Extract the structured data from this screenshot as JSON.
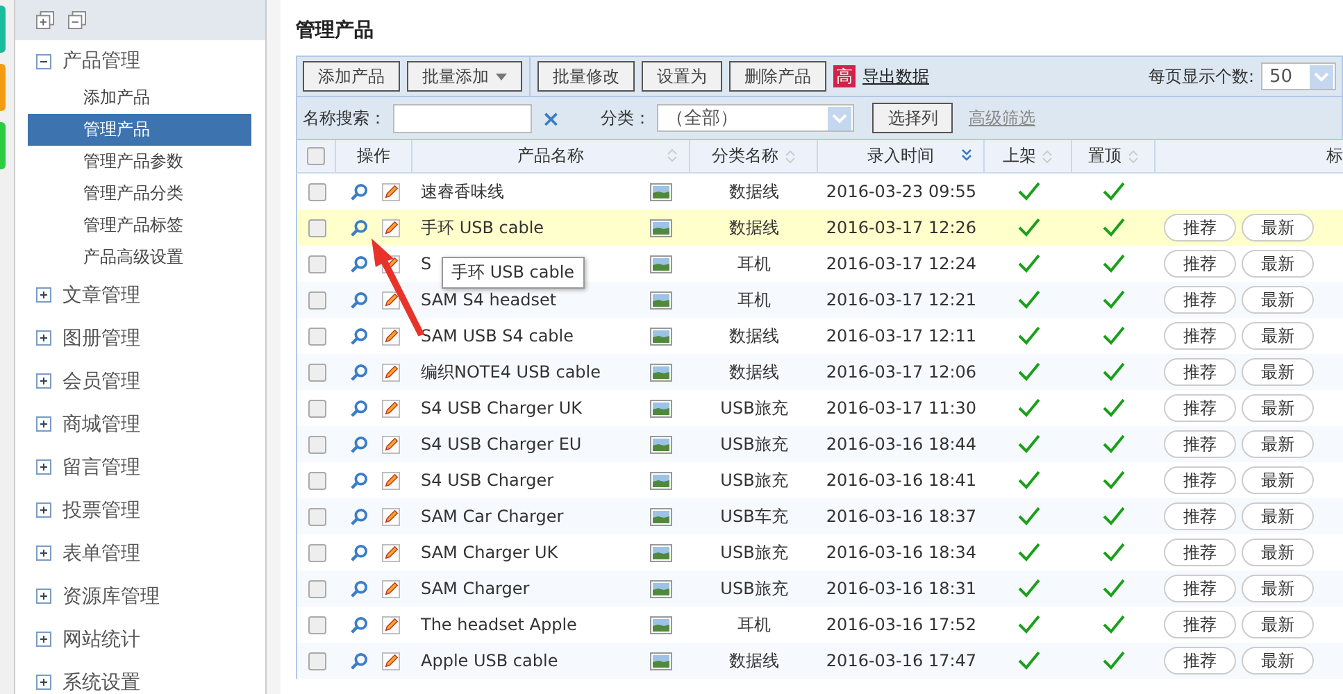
{
  "sidebar": {
    "groups": [
      {
        "label": "产品管理",
        "expanded": true,
        "children": [
          {
            "label": "添加产品",
            "selected": false
          },
          {
            "label": "管理产品",
            "selected": true
          },
          {
            "label": "管理产品参数",
            "selected": false
          },
          {
            "label": "管理产品分类",
            "selected": false
          },
          {
            "label": "管理产品标签",
            "selected": false
          },
          {
            "label": "产品高级设置",
            "selected": false
          }
        ]
      },
      {
        "label": "文章管理",
        "expanded": false
      },
      {
        "label": "图册管理",
        "expanded": false
      },
      {
        "label": "会员管理",
        "expanded": false
      },
      {
        "label": "商城管理",
        "expanded": false
      },
      {
        "label": "留言管理",
        "expanded": false
      },
      {
        "label": "投票管理",
        "expanded": false
      },
      {
        "label": "表单管理",
        "expanded": false
      },
      {
        "label": "资源库管理",
        "expanded": false
      },
      {
        "label": "网站统计",
        "expanded": false
      },
      {
        "label": "系统设置",
        "expanded": false
      }
    ]
  },
  "page_title": "管理产品",
  "toolbar": {
    "buttons": [
      {
        "label": "添加产品",
        "dropdown": false
      },
      {
        "label": "批量添加",
        "dropdown": true
      },
      {
        "label": "批量修改",
        "dropdown": false
      },
      {
        "label": "设置为",
        "dropdown": false
      },
      {
        "label": "删除产品",
        "dropdown": false
      }
    ],
    "export_badge": "高",
    "export_link": "导出数据",
    "per_page_label": "每页显示个数:",
    "per_page": "50"
  },
  "filter": {
    "search_label": "名称搜索：",
    "clear": "×",
    "category_label": "分类：",
    "category": "（全部）",
    "columns_button": "选择列",
    "advanced_link": "高级筛选"
  },
  "table": {
    "all_checked": false,
    "columns": [
      "操作",
      "产品名称",
      "分类名称",
      "录入时间",
      "上架",
      "置顶",
      "标"
    ],
    "rows": [
      {
        "name": "速睿香味线",
        "category": "数据线",
        "time": "2016-03-23 09:55",
        "listed": true,
        "pinned": true,
        "tags": [],
        "highlighted": false
      },
      {
        "name": "手环 USB cable",
        "category": "数据线",
        "time": "2016-03-17 12:26",
        "listed": true,
        "pinned": true,
        "tags": [
          "推荐",
          "最新"
        ],
        "highlighted": true
      },
      {
        "name": "S",
        "category": "耳机",
        "time": "2016-03-17 12:24",
        "listed": true,
        "pinned": true,
        "tags": [
          "推荐",
          "最新"
        ],
        "highlighted": false
      },
      {
        "name": "SAM S4 headset",
        "category": "耳机",
        "time": "2016-03-17 12:21",
        "listed": true,
        "pinned": true,
        "tags": [
          "推荐",
          "最新"
        ],
        "highlighted": false
      },
      {
        "name": "SAM USB S4 cable",
        "category": "数据线",
        "time": "2016-03-17 12:11",
        "listed": true,
        "pinned": true,
        "tags": [
          "推荐",
          "最新"
        ],
        "highlighted": false
      },
      {
        "name": "编织NOTE4 USB cable",
        "category": "数据线",
        "time": "2016-03-17 12:06",
        "listed": true,
        "pinned": true,
        "tags": [
          "推荐",
          "最新"
        ],
        "highlighted": false
      },
      {
        "name": "S4 USB Charger UK",
        "category": "USB旅充",
        "time": "2016-03-17 11:30",
        "listed": true,
        "pinned": true,
        "tags": [
          "推荐",
          "最新"
        ],
        "highlighted": false
      },
      {
        "name": "S4 USB Charger EU",
        "category": "USB旅充",
        "time": "2016-03-16 18:44",
        "listed": true,
        "pinned": true,
        "tags": [
          "推荐",
          "最新"
        ],
        "highlighted": false
      },
      {
        "name": "S4 USB Charger",
        "category": "USB旅充",
        "time": "2016-03-16 18:41",
        "listed": true,
        "pinned": true,
        "tags": [
          "推荐",
          "最新"
        ],
        "highlighted": false
      },
      {
        "name": "SAM Car Charger",
        "category": "USB车充",
        "time": "2016-03-16 18:37",
        "listed": true,
        "pinned": true,
        "tags": [
          "推荐",
          "最新"
        ],
        "highlighted": false
      },
      {
        "name": "SAM Charger UK",
        "category": "USB旅充",
        "time": "2016-03-16 18:34",
        "listed": true,
        "pinned": true,
        "tags": [
          "推荐",
          "最新"
        ],
        "highlighted": false
      },
      {
        "name": "SAM Charger",
        "category": "USB旅充",
        "time": "2016-03-16 18:31",
        "listed": true,
        "pinned": true,
        "tags": [
          "推荐",
          "最新"
        ],
        "highlighted": false
      },
      {
        "name": "The headset Apple",
        "category": "耳机",
        "time": "2016-03-16 17:52",
        "listed": true,
        "pinned": true,
        "tags": [
          "推荐",
          "最新"
        ],
        "highlighted": false
      },
      {
        "name": "Apple USB cable",
        "category": "数据线",
        "time": "2016-03-16 17:47",
        "listed": true,
        "pinned": true,
        "tags": [
          "推荐",
          "最新"
        ],
        "highlighted": false
      }
    ]
  },
  "tooltip": "手环 USB cable"
}
